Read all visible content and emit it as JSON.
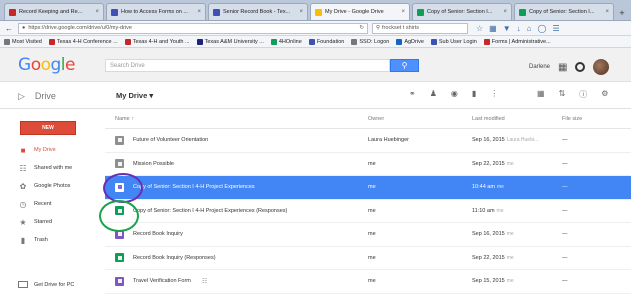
{
  "browser": {
    "tabs": [
      {
        "title": "Record Keeping and Re...",
        "fav_color": "#c62828",
        "active": false
      },
      {
        "title": "How to Access Forms on ...",
        "fav_color": "#3f51b5",
        "active": false
      },
      {
        "title": "Senior Record Book - Tex...",
        "fav_color": "#3f51b5",
        "active": false
      },
      {
        "title": "My Drive - Google Drive",
        "fav_color": "#fbbc05",
        "active": true
      },
      {
        "title": "Copy of Senior: Section I...",
        "fav_color": "#0f9d58",
        "active": false
      },
      {
        "title": "Copy of Senior: Section I...",
        "fav_color": "#0f9d58",
        "active": false
      }
    ],
    "new_tab": "+",
    "url": "https://drive.google.com/drive/u/0/my-drive",
    "search_value": "frockset t shirts",
    "bookmarks": [
      {
        "label": "Most Visited",
        "fav_color": "#777777"
      },
      {
        "label": "Texas 4-H Conference ...",
        "fav_color": "#c62828"
      },
      {
        "label": "Texas 4-H and Youth ...",
        "fav_color": "#c62828"
      },
      {
        "label": "Texas A&M University ...",
        "fav_color": "#1a237e"
      },
      {
        "label": "4HOnline",
        "fav_color": "#0f9d58"
      },
      {
        "label": "Foundation",
        "fav_color": "#3f51b5"
      },
      {
        "label": "SSO: Logon",
        "fav_color": "#777777"
      },
      {
        "label": "AgDrive",
        "fav_color": "#1565c0"
      },
      {
        "label": "Sub User Login",
        "fav_color": "#3f51b5"
      },
      {
        "label": "Forms | Administrative...",
        "fav_color": "#c62828"
      }
    ]
  },
  "header": {
    "logo_parts": [
      "G",
      "o",
      "o",
      "g",
      "l",
      "e"
    ],
    "search_placeholder": "Search Drive",
    "user_name": "Darlene"
  },
  "toolbar": {
    "brand": "Drive",
    "location": "My Drive ▾"
  },
  "sidebar": {
    "new_label": "NEW",
    "items": [
      {
        "label": "My Drive",
        "icon": "■",
        "active": true
      },
      {
        "label": "Shared with me",
        "icon": "☷",
        "active": false
      },
      {
        "label": "Google Photos",
        "icon": "✿",
        "active": false
      },
      {
        "label": "Recent",
        "icon": "◷",
        "active": false
      },
      {
        "label": "Starred",
        "icon": "★",
        "active": false
      },
      {
        "label": "Trash",
        "icon": "▮",
        "active": false
      }
    ],
    "get_drive": "Get Drive for PC"
  },
  "list": {
    "columns": {
      "name": "Name ↑",
      "owner": "Owner",
      "modified": "Last modified",
      "size": "File size"
    },
    "rows": [
      {
        "type": "folder",
        "name": "Future of Volunteer Orientation",
        "owner": "Laura Huebinger",
        "modified": "Sep 16, 2015",
        "mod_by": "Laura Huebi...",
        "size": "—",
        "selected": false
      },
      {
        "type": "folder",
        "name": "Mission Possible",
        "owner": "me",
        "modified": "Sep 22, 2015",
        "mod_by": "me",
        "size": "—",
        "selected": false
      },
      {
        "type": "form",
        "name": "Copy of Senior: Section I 4-H Project Experiences",
        "owner": "me",
        "modified": "10:44 am",
        "mod_by": "me",
        "size": "—",
        "selected": true
      },
      {
        "type": "sheet",
        "name": "Copy of Senior: Section I 4-H Project Experiences (Responses)",
        "owner": "me",
        "modified": "11:10 am",
        "mod_by": "me",
        "size": "—",
        "selected": false
      },
      {
        "type": "form",
        "name": "Record Book Inquiry",
        "owner": "me",
        "modified": "Sep 16, 2015",
        "mod_by": "me",
        "size": "—",
        "selected": false
      },
      {
        "type": "sheet",
        "name": "Record Book Inquiry (Responses)",
        "owner": "me",
        "modified": "Sep 22, 2015",
        "mod_by": "me",
        "size": "—",
        "selected": false
      },
      {
        "type": "form",
        "name": "Travel Verification Form",
        "shared": true,
        "owner": "me",
        "modified": "Sep 15, 2015",
        "mod_by": "me",
        "size": "—",
        "selected": false
      }
    ]
  },
  "annotations": {
    "purple_circle_color": "#6a2fb0",
    "green_circle_color": "#19a34a"
  }
}
